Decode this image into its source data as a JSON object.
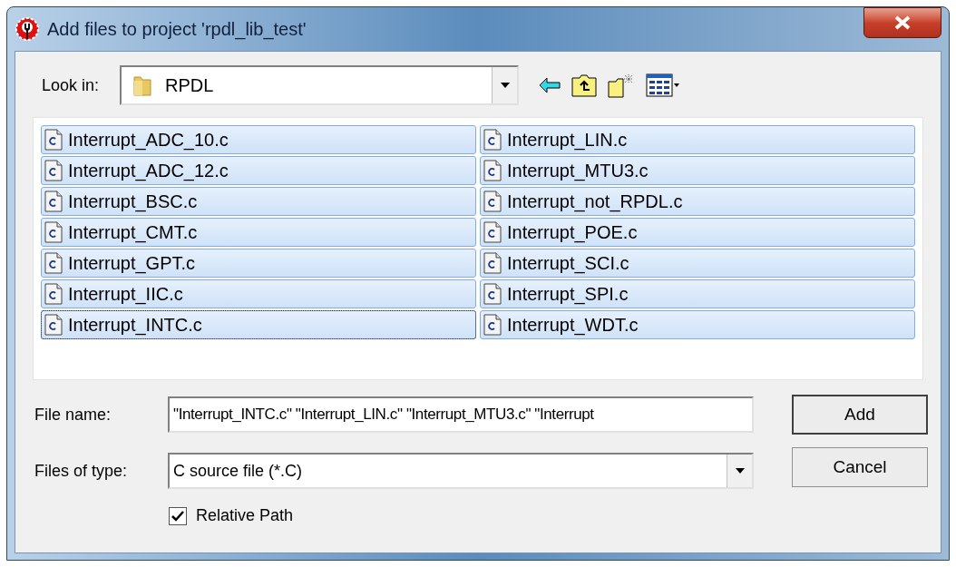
{
  "window": {
    "title": "Add files to project 'rpdl_lib_test'"
  },
  "look_in": {
    "label": "Look in:",
    "value": "RPDL"
  },
  "files": [
    {
      "name": "Interrupt_ADC_10.c",
      "selected": true,
      "focused": false
    },
    {
      "name": "Interrupt_ADC_12.c",
      "selected": true,
      "focused": false
    },
    {
      "name": "Interrupt_BSC.c",
      "selected": true,
      "focused": false
    },
    {
      "name": "Interrupt_CMT.c",
      "selected": true,
      "focused": false
    },
    {
      "name": "Interrupt_GPT.c",
      "selected": true,
      "focused": false
    },
    {
      "name": "Interrupt_IIC.c",
      "selected": true,
      "focused": false
    },
    {
      "name": "Interrupt_INTC.c",
      "selected": true,
      "focused": true
    },
    {
      "name": "Interrupt_LIN.c",
      "selected": true,
      "focused": false
    },
    {
      "name": "Interrupt_MTU3.c",
      "selected": true,
      "focused": false
    },
    {
      "name": "Interrupt_not_RPDL.c",
      "selected": true,
      "focused": false
    },
    {
      "name": "Interrupt_POE.c",
      "selected": true,
      "focused": false
    },
    {
      "name": "Interrupt_SCI.c",
      "selected": true,
      "focused": false
    },
    {
      "name": "Interrupt_SPI.c",
      "selected": true,
      "focused": false
    },
    {
      "name": "Interrupt_WDT.c",
      "selected": true,
      "focused": false
    }
  ],
  "file_name": {
    "label": "File name:",
    "value": "\"Interrupt_INTC.c\" \"Interrupt_LIN.c\" \"Interrupt_MTU3.c\" \"Interrupt"
  },
  "files_of_type": {
    "label": "Files of type:",
    "value": "C source file (*.C)"
  },
  "relative_path": {
    "label": "Relative Path",
    "checked": true
  },
  "buttons": [
    {
      "label": "Add",
      "default": true
    },
    {
      "label": "Cancel",
      "default": false
    }
  ]
}
